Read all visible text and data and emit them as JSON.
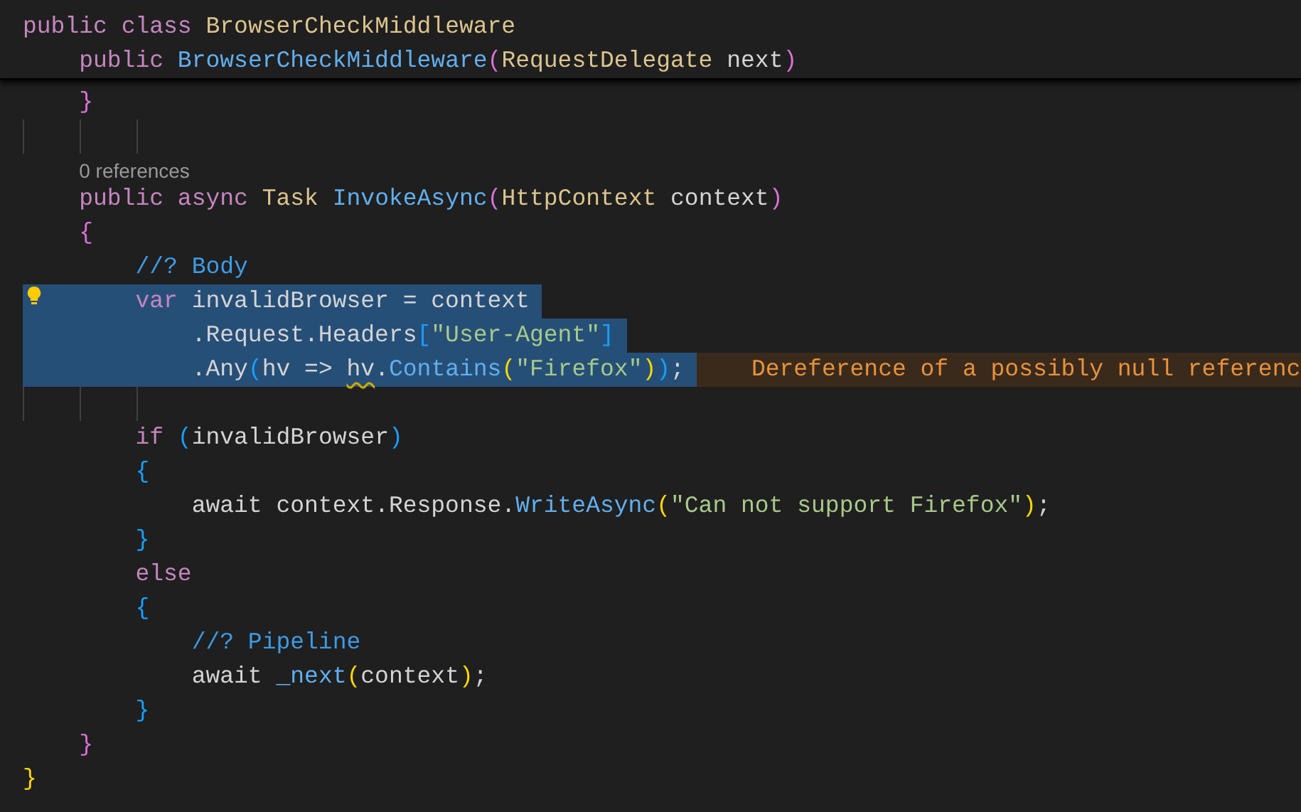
{
  "sticky_header": {
    "lines": [
      {
        "tokens": [
          {
            "text": "public",
            "kind": "keyword"
          },
          {
            "text": " class",
            "kind": "keyword"
          },
          {
            "text": " BrowserCheckMiddleware",
            "kind": "type"
          }
        ]
      },
      {
        "tokens": [
          {
            "text": "    public",
            "kind": "keyword"
          },
          {
            "text": " BrowserCheckMiddleware",
            "kind": "method"
          },
          {
            "text": "(",
            "kind": "bracket1"
          },
          {
            "text": "RequestDelegate",
            "kind": "type"
          },
          {
            "text": " next",
            "kind": "plain"
          },
          {
            "text": ")",
            "kind": "bracket1"
          }
        ]
      }
    ]
  },
  "editor": {
    "lines": [
      {
        "tokens": [
          {
            "text": "    }",
            "kind": "bracket1"
          }
        ]
      },
      {
        "kind": "blank"
      },
      {
        "tokens": [
          {
            "text": "    0 references",
            "kind": "codelens"
          }
        ]
      },
      {
        "tokens": [
          {
            "text": "    public",
            "kind": "keyword"
          },
          {
            "text": " async",
            "kind": "keyword"
          },
          {
            "text": " Task",
            "kind": "type"
          },
          {
            "text": " InvokeAsync",
            "kind": "method"
          },
          {
            "text": "(",
            "kind": "bracket1"
          },
          {
            "text": "HttpContext",
            "kind": "type"
          },
          {
            "text": " context",
            "kind": "plain"
          },
          {
            "text": ")",
            "kind": "bracket1"
          }
        ]
      },
      {
        "tokens": [
          {
            "text": "    {",
            "kind": "bracket1"
          }
        ]
      },
      {
        "tokens": [
          {
            "text": "        //? Body",
            "kind": "comment"
          }
        ]
      },
      {
        "selected": true,
        "lightbulb": true,
        "tokens": [
          {
            "text": "        var",
            "kind": "keyword"
          },
          {
            "text": " invalidBrowser = context",
            "kind": "plain"
          }
        ]
      },
      {
        "selected": true,
        "tokens": [
          {
            "text": "            .Request.Headers",
            "kind": "plain"
          },
          {
            "text": "[",
            "kind": "bracket3"
          },
          {
            "text": "\"User-Agent\"",
            "kind": "string"
          },
          {
            "text": "]",
            "kind": "bracket3"
          }
        ]
      },
      {
        "selected": true,
        "diagnostic": "Dereference of a possibly null referenc",
        "tokens": [
          {
            "text": "            .Any",
            "kind": "plain"
          },
          {
            "text": "(",
            "kind": "bracket3"
          },
          {
            "text": "hv => ",
            "kind": "plain"
          },
          {
            "text": "hv",
            "kind": "plain",
            "squiggle": true
          },
          {
            "text": ".",
            "kind": "plain"
          },
          {
            "text": "Contains",
            "kind": "method"
          },
          {
            "text": "(",
            "kind": "bracket2"
          },
          {
            "text": "\"Firefox\"",
            "kind": "string"
          },
          {
            "text": ")",
            "kind": "bracket2"
          },
          {
            "text": ")",
            "kind": "bracket3"
          },
          {
            "text": ";",
            "kind": "plain"
          }
        ]
      },
      {
        "kind": "blank"
      },
      {
        "tokens": [
          {
            "text": "        if",
            "kind": "keyword"
          },
          {
            "text": " (",
            "kind": "bracket3"
          },
          {
            "text": "invalidBrowser",
            "kind": "plain"
          },
          {
            "text": ")",
            "kind": "bracket3"
          }
        ]
      },
      {
        "tokens": [
          {
            "text": "        {",
            "kind": "bracket3"
          }
        ]
      },
      {
        "tokens": [
          {
            "text": "            await context.Response.",
            "kind": "plain"
          },
          {
            "text": "WriteAsync",
            "kind": "method"
          },
          {
            "text": "(",
            "kind": "bracket2"
          },
          {
            "text": "\"Can not support Firefox\"",
            "kind": "string"
          },
          {
            "text": ")",
            "kind": "bracket2"
          },
          {
            "text": ";",
            "kind": "plain"
          }
        ]
      },
      {
        "tokens": [
          {
            "text": "        }",
            "kind": "bracket3"
          }
        ]
      },
      {
        "tokens": [
          {
            "text": "        else",
            "kind": "keyword"
          }
        ]
      },
      {
        "tokens": [
          {
            "text": "        {",
            "kind": "bracket3"
          }
        ]
      },
      {
        "tokens": [
          {
            "text": "            //? Pipeline",
            "kind": "comment"
          }
        ]
      },
      {
        "tokens": [
          {
            "text": "            await ",
            "kind": "plain"
          },
          {
            "text": "_next",
            "kind": "method"
          },
          {
            "text": "(",
            "kind": "bracket2"
          },
          {
            "text": "context",
            "kind": "plain"
          },
          {
            "text": ")",
            "kind": "bracket2"
          },
          {
            "text": ";",
            "kind": "plain"
          }
        ]
      },
      {
        "tokens": [
          {
            "text": "        }",
            "kind": "bracket3"
          }
        ]
      },
      {
        "tokens": [
          {
            "text": "    }",
            "kind": "bracket1"
          }
        ]
      },
      {
        "tokens": [
          {
            "text": "}",
            "kind": "bracket2"
          }
        ]
      }
    ]
  }
}
